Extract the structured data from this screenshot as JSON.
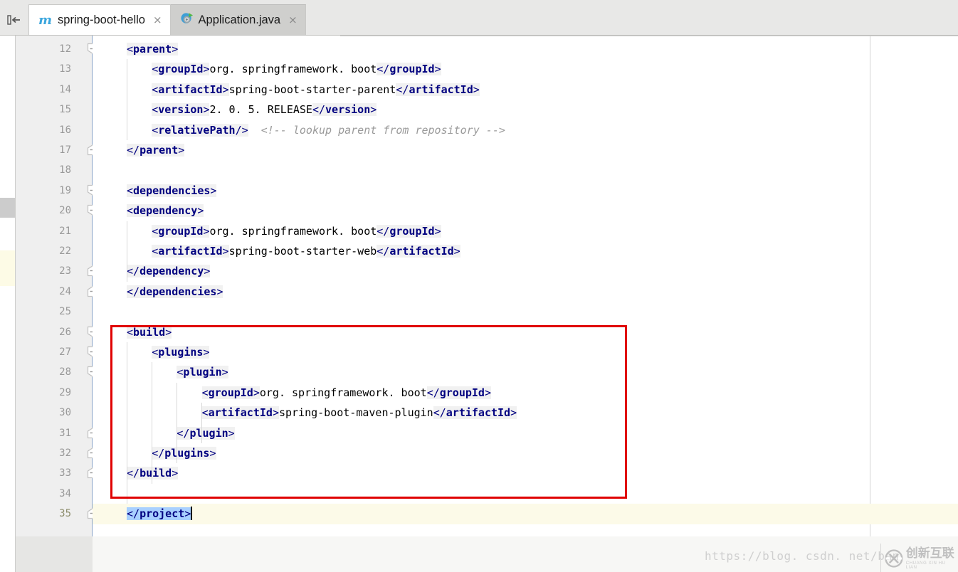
{
  "window": {
    "app": "IntelliJ IDEA editor",
    "sidebar_toggle_icon": "collapse-sidebar-icon"
  },
  "tabs": [
    {
      "label": "spring-boot-hello",
      "icon": "maven-m-icon",
      "close": "×",
      "active": true
    },
    {
      "label": "Application.java",
      "icon": "spring-boot-run-icon",
      "close": "×",
      "active": false
    }
  ],
  "editor": {
    "first_line_number": 12,
    "caret_line": 35,
    "selected_text": "</project>",
    "lines": [
      {
        "n": "12",
        "indent": 0,
        "html": "<span class=\"tok\"><span class=\"ang\">&lt;</span><span class=\"tag\">parent</span><span class=\"ang\">&gt;</span></span>",
        "text": "<parent>"
      },
      {
        "n": "13",
        "indent": 1,
        "html": "<span class=\"tok\"><span class=\"ang\">&lt;</span><span class=\"tag\">groupId</span><span class=\"ang\">&gt;</span></span><span class=\"val\">org. springframework. boot</span><span class=\"tok\"><span class=\"ang\">&lt;/</span><span class=\"tag\">groupId</span><span class=\"ang\">&gt;</span></span>",
        "text": "<groupId>org. springframework. boot</groupId>"
      },
      {
        "n": "14",
        "indent": 1,
        "html": "<span class=\"tok\"><span class=\"ang\">&lt;</span><span class=\"tag\">artifactId</span><span class=\"ang\">&gt;</span></span><span class=\"val\">spring-boot-starter-parent</span><span class=\"tok\"><span class=\"ang\">&lt;/</span><span class=\"tag\">artifactId</span><span class=\"ang\">&gt;</span></span>",
        "text": "<artifactId>spring-boot-starter-parent</artifactId>"
      },
      {
        "n": "15",
        "indent": 1,
        "html": "<span class=\"tok\"><span class=\"ang\">&lt;</span><span class=\"tag\">version</span><span class=\"ang\">&gt;</span></span><span class=\"val\">2. 0. 5. RELEASE</span><span class=\"tok\"><span class=\"ang\">&lt;/</span><span class=\"tag\">version</span><span class=\"ang\">&gt;</span></span>",
        "text": "<version>2. 0. 5. RELEASE</version>"
      },
      {
        "n": "16",
        "indent": 1,
        "html": "<span class=\"tok\"><span class=\"ang\">&lt;</span><span class=\"tag\">relativePath</span><span class=\"ang\">/&gt;</span></span><span class=\"comment\">  &lt;!-- lookup parent from repository --&gt;</span>",
        "text": "<relativePath/>  <!-- lookup parent from repository -->"
      },
      {
        "n": "17",
        "indent": 0,
        "html": "<span class=\"tok\"><span class=\"ang\">&lt;/</span><span class=\"tag\">parent</span><span class=\"ang\">&gt;</span></span>",
        "text": "</parent>"
      },
      {
        "n": "18",
        "indent": 0,
        "html": "",
        "text": ""
      },
      {
        "n": "19",
        "indent": 0,
        "html": "<span class=\"tok\"><span class=\"ang\">&lt;</span><span class=\"tag\">dependencies</span><span class=\"ang\">&gt;</span></span>",
        "text": "<dependencies>"
      },
      {
        "n": "20",
        "indent": 0,
        "html": "<span class=\"tok\"><span class=\"ang\">&lt;</span><span class=\"tag\">dependency</span><span class=\"ang\">&gt;</span></span>",
        "text": "<dependency>"
      },
      {
        "n": "21",
        "indent": 1,
        "html": "<span class=\"tok\"><span class=\"ang\">&lt;</span><span class=\"tag\">groupId</span><span class=\"ang\">&gt;</span></span><span class=\"val\">org. springframework. boot</span><span class=\"tok\"><span class=\"ang\">&lt;/</span><span class=\"tag\">groupId</span><span class=\"ang\">&gt;</span></span>",
        "text": "<groupId>org. springframework. boot</groupId>"
      },
      {
        "n": "22",
        "indent": 1,
        "html": "<span class=\"tok\"><span class=\"ang\">&lt;</span><span class=\"tag\">artifactId</span><span class=\"ang\">&gt;</span></span><span class=\"val\">spring-boot-starter-web</span><span class=\"tok\"><span class=\"ang\">&lt;/</span><span class=\"tag\">artifactId</span><span class=\"ang\">&gt;</span></span>",
        "text": "<artifactId>spring-boot-starter-web</artifactId>"
      },
      {
        "n": "23",
        "indent": 0,
        "html": "<span class=\"tok\"><span class=\"ang\">&lt;/</span><span class=\"tag\">dependency</span><span class=\"ang\">&gt;</span></span>",
        "text": "</dependency>"
      },
      {
        "n": "24",
        "indent": 0,
        "html": "<span class=\"tok\"><span class=\"ang\">&lt;/</span><span class=\"tag\">dependencies</span><span class=\"ang\">&gt;</span></span>",
        "text": "</dependencies>"
      },
      {
        "n": "25",
        "indent": 0,
        "html": "",
        "text": ""
      },
      {
        "n": "26",
        "indent": 0,
        "html": "<span class=\"tok\"><span class=\"ang\">&lt;</span><span class=\"tag\">build</span><span class=\"ang\">&gt;</span></span>",
        "text": "<build>"
      },
      {
        "n": "27",
        "indent": 1,
        "html": "<span class=\"tok\"><span class=\"ang\">&lt;</span><span class=\"tag\">plugins</span><span class=\"ang\">&gt;</span></span>",
        "text": "<plugins>"
      },
      {
        "n": "28",
        "indent": 2,
        "html": "<span class=\"tok\"><span class=\"ang\">&lt;</span><span class=\"tag\">plugin</span><span class=\"ang\">&gt;</span></span>",
        "text": "<plugin>"
      },
      {
        "n": "29",
        "indent": 3,
        "html": "<span class=\"tok\"><span class=\"ang\">&lt;</span><span class=\"tag\">groupId</span><span class=\"ang\">&gt;</span></span><span class=\"val\">org. springframework. boot</span><span class=\"tok\"><span class=\"ang\">&lt;/</span><span class=\"tag\">groupId</span><span class=\"ang\">&gt;</span></span>",
        "text": "<groupId>org. springframework. boot</groupId>"
      },
      {
        "n": "30",
        "indent": 3,
        "html": "<span class=\"tok\"><span class=\"ang\">&lt;</span><span class=\"tag\">artifactId</span><span class=\"ang\">&gt;</span></span><span class=\"val\">spring-boot-maven-plugin</span><span class=\"tok\"><span class=\"ang\">&lt;/</span><span class=\"tag\">artifactId</span><span class=\"ang\">&gt;</span></span>",
        "text": "<artifactId>spring-boot-maven-plugin</artifactId>"
      },
      {
        "n": "31",
        "indent": 2,
        "html": "<span class=\"tok\"><span class=\"ang\">&lt;/</span><span class=\"tag\">plugin</span><span class=\"ang\">&gt;</span></span>",
        "text": "</plugin>"
      },
      {
        "n": "32",
        "indent": 1,
        "html": "<span class=\"tok\"><span class=\"ang\">&lt;/</span><span class=\"tag\">plugins</span><span class=\"ang\">&gt;</span></span>",
        "text": "</plugins>"
      },
      {
        "n": "33",
        "indent": 0,
        "html": "<span class=\"tok\"><span class=\"ang\">&lt;/</span><span class=\"tag\">build</span><span class=\"ang\">&gt;</span></span>",
        "text": "</build>"
      },
      {
        "n": "34",
        "indent": 0,
        "html": "",
        "text": ""
      },
      {
        "n": "35",
        "indent": 0,
        "current": true,
        "html": "<span class=\"sel\"><span class=\"ang\">&lt;/</span><span class=\"tag\">project</span><span class=\"ang\">&gt;</span></span><span class=\"caret\"></span>",
        "text": "</project>"
      }
    ],
    "fold_markers": [
      {
        "line": "12",
        "type": "collapse"
      },
      {
        "line": "17",
        "type": "end"
      },
      {
        "line": "19",
        "type": "collapse"
      },
      {
        "line": "20",
        "type": "collapse"
      },
      {
        "line": "23",
        "type": "end"
      },
      {
        "line": "24",
        "type": "end"
      },
      {
        "line": "26",
        "type": "collapse"
      },
      {
        "line": "27",
        "type": "collapse"
      },
      {
        "line": "28",
        "type": "collapse"
      },
      {
        "line": "31",
        "type": "end"
      },
      {
        "line": "32",
        "type": "end"
      },
      {
        "line": "33",
        "type": "end"
      },
      {
        "line": "35",
        "type": "end"
      }
    ]
  },
  "annotation": {
    "type": "red-rectangle-highlight",
    "color": "#e00000",
    "covers_lines": "26-33"
  },
  "watermark": {
    "url": "https://blog. csdn. net/ban",
    "logo_cn": "创新互联",
    "logo_pinyin": "CHUANG XIN HU LIAN",
    "logo_mark": "X"
  },
  "colors": {
    "tag": "#000080",
    "text": "#000000",
    "comment": "#9a9a9a",
    "selection": "#a8d0ff",
    "current_line": "#fcfae8",
    "token_bg": "#f1f1f1",
    "gutter_bg": "#efefef",
    "tabbar_bg": "#e8e8e7",
    "annotation": "#e00000"
  }
}
